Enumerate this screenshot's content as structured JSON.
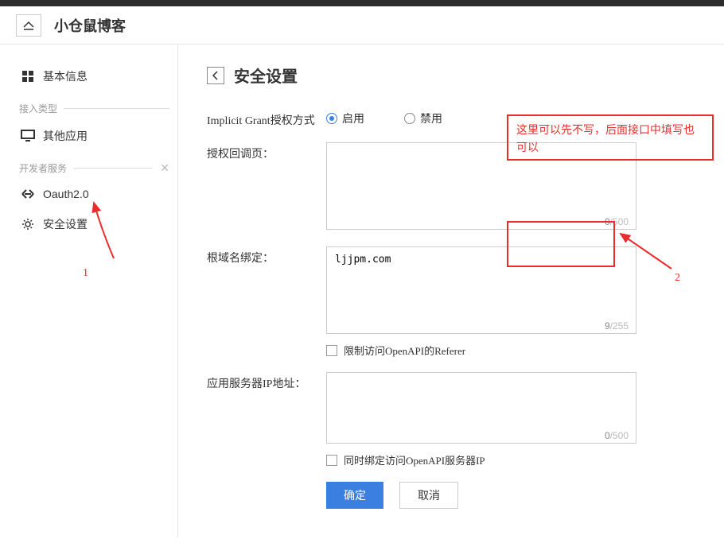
{
  "header": {
    "title": "小仓鼠博客"
  },
  "sidebar": {
    "items": {
      "basic": {
        "label": "基本信息"
      },
      "other": {
        "label": "其他应用"
      },
      "oauth": {
        "label": "Oauth2.0"
      },
      "security": {
        "label": "安全设置"
      }
    },
    "sections": {
      "access_type": "接入类型",
      "dev_service": "开发者服务"
    }
  },
  "page": {
    "title": "安全设置"
  },
  "form": {
    "grant": {
      "label": "Implicit Grant授权方式",
      "enable": "启用",
      "disable": "禁用"
    },
    "callback": {
      "label": "授权回调页：",
      "value": "",
      "count": "0",
      "max": "/500"
    },
    "domain": {
      "label": "根域名绑定：",
      "value": "ljjpm.com",
      "count": "9",
      "max": "/255",
      "checkbox_label": "限制访问OpenAPI的Referer"
    },
    "serverip": {
      "label": "应用服务器IP地址：",
      "value": "",
      "count": "0",
      "max": "/500",
      "checkbox_label": "同时绑定访问OpenAPI服务器IP"
    },
    "buttons": {
      "ok": "确定",
      "cancel": "取消"
    }
  },
  "annotations": {
    "box1_text": "这里可以先不写，后面接口中填写也可以",
    "num1": "1",
    "num2": "2"
  }
}
